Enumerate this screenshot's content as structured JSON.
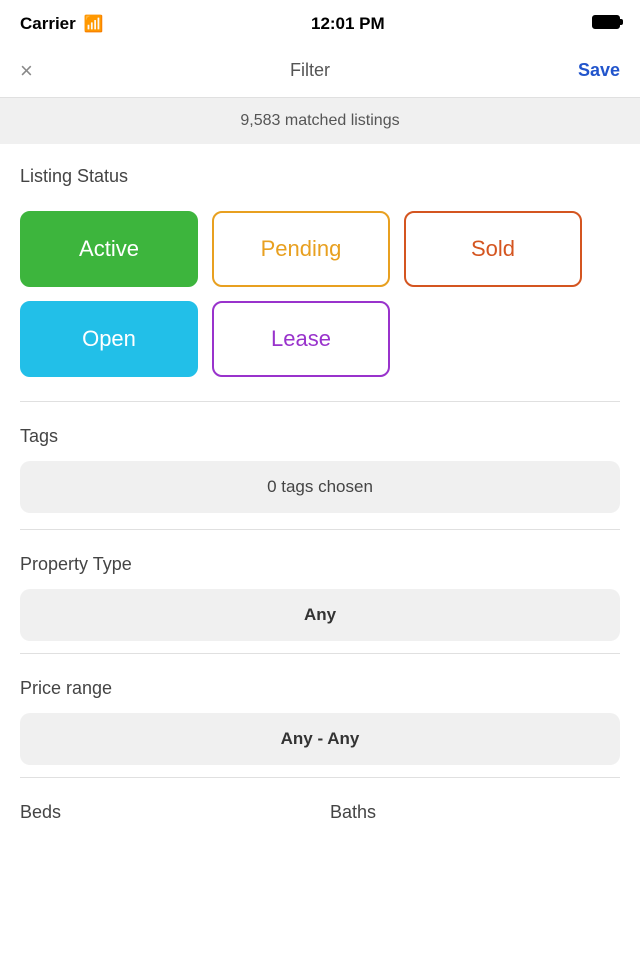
{
  "statusBar": {
    "carrier": "Carrier",
    "time": "12:01 PM"
  },
  "nav": {
    "title": "Filter",
    "save": "Save",
    "close": "×"
  },
  "banner": {
    "text": "9,583 matched listings"
  },
  "listingStatus": {
    "label": "Listing Status",
    "buttons": [
      {
        "id": "active",
        "label": "Active",
        "style": "active-btn"
      },
      {
        "id": "pending",
        "label": "Pending",
        "style": "pending-btn"
      },
      {
        "id": "sold",
        "label": "Sold",
        "style": "sold-btn"
      },
      {
        "id": "open",
        "label": "Open",
        "style": "open-btn"
      },
      {
        "id": "lease",
        "label": "Lease",
        "style": "lease-btn"
      }
    ]
  },
  "tags": {
    "label": "Tags",
    "button": "0 tags chosen"
  },
  "propertyType": {
    "label": "Property Type",
    "button": "Any"
  },
  "priceRange": {
    "label": "Price range",
    "button": "Any - Any"
  },
  "bedsLabel": "Beds",
  "bathsLabel": "Baths"
}
